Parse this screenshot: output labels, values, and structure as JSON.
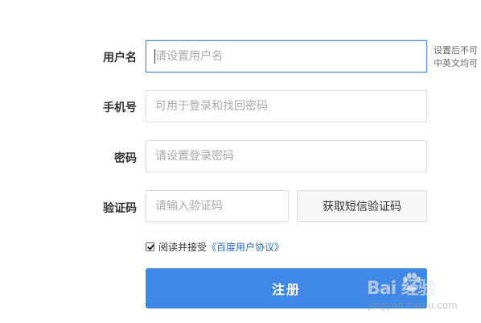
{
  "form": {
    "username": {
      "label": "用户名",
      "placeholder": "请设置用户名",
      "value": "",
      "hint": "设置后不可\n中英文均可"
    },
    "phone": {
      "label": "手机号",
      "placeholder": "可用于登录和找回密码",
      "value": ""
    },
    "password": {
      "label": "密码",
      "placeholder": "请设置登录密码",
      "value": ""
    },
    "captcha": {
      "label": "验证码",
      "placeholder": "请输入验证码",
      "value": "",
      "button_label": "获取短信验证码"
    },
    "agreement": {
      "checked": true,
      "text": "阅读并接受",
      "link_text": "《百度用户协议》"
    },
    "submit_label": "注册"
  },
  "watermark": {
    "brand": "Bai 经验",
    "url": "jingyan.baidu.com"
  },
  "colors": {
    "primary": "#3f88e6",
    "focus_border": "#4a90e2",
    "link": "#2a6bbf",
    "input_border": "#dddddd",
    "label_text": "#333333"
  },
  "icons": {
    "checkbox": "checkmark-icon",
    "watermark_logo": "baidu-paw-icon"
  }
}
